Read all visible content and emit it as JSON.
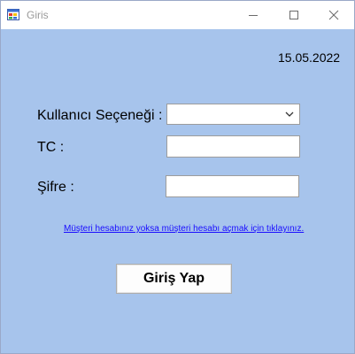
{
  "window": {
    "title": "Giris",
    "icon": "windows-form-icon",
    "controls": [
      "minimize-icon",
      "maximize-icon",
      "close-icon"
    ]
  },
  "form": {
    "date": "15.05.2022",
    "user_option_label": "Kullanıcı Seçeneği :",
    "user_option_value": "",
    "tc_label": "TC :",
    "tc_value": "",
    "password_label": "Şifre :",
    "password_value": "",
    "register_link": "Müşteri hesabınız yoksa müşteri hesabı açmak için tıklayınız.",
    "login_button": "Giriş Yap"
  },
  "colors": {
    "client_background": "#a7c4ec",
    "link": "#1a0dff"
  }
}
